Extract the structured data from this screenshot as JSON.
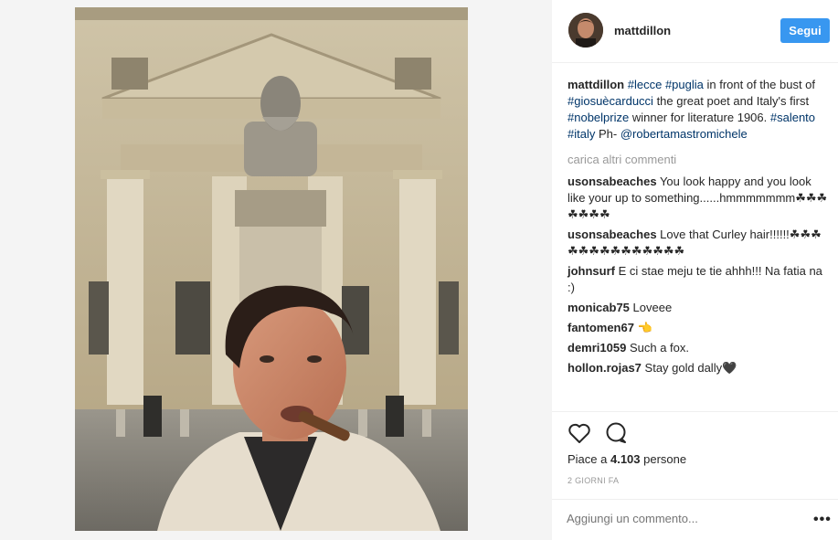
{
  "header": {
    "username": "mattdillon",
    "follow_label": "Segui"
  },
  "caption": {
    "username": "mattdillon",
    "segments": [
      {
        "t": "tag",
        "v": "#lecce"
      },
      {
        "t": "txt",
        "v": " "
      },
      {
        "t": "tag",
        "v": "#puglia"
      },
      {
        "t": "txt",
        "v": " in front of the bust of "
      },
      {
        "t": "tag",
        "v": "#giosuècarducci"
      },
      {
        "t": "txt",
        "v": " the great poet and Italy's first "
      },
      {
        "t": "tag",
        "v": "#nobelprize"
      },
      {
        "t": "txt",
        "v": " winner for literature 1906. "
      },
      {
        "t": "tag",
        "v": "#salento"
      },
      {
        "t": "txt",
        "v": " "
      },
      {
        "t": "tag",
        "v": "#italy"
      },
      {
        "t": "txt",
        "v": " Ph- "
      },
      {
        "t": "tag",
        "v": "@robertamastromichele"
      }
    ]
  },
  "load_more_label": "carica altri commenti",
  "comments": [
    {
      "user": "usonsabeaches",
      "text": "You look happy and you look like your up to something......hmmmmmmm☘☘☘☘☘☘☘"
    },
    {
      "user": "usonsabeaches",
      "text": "Love that Curley hair!!!!!!☘☘☘☘☘☘☘☘☘☘☘☘☘☘"
    },
    {
      "user": "johnsurf",
      "text": "E ci stae meju te tie ahhh!!! Na fatia na :)"
    },
    {
      "user": "monicab75",
      "text": "Loveee"
    },
    {
      "user": "fantomen67",
      "text": "👈"
    },
    {
      "user": "demri1059",
      "text": "Such a fox."
    },
    {
      "user": "hollon.rojas7",
      "text": "Stay gold dally🖤"
    }
  ],
  "actions": {
    "like_icon": "heart-outline-icon",
    "comment_icon": "speech-bubble-icon"
  },
  "likes": {
    "prefix": "Piace a ",
    "count": "4.103",
    "suffix": " persone"
  },
  "timestamp": "2 GIORNI FA",
  "add_comment_placeholder": "Aggiungi un commento...",
  "more_options_label": "•••",
  "colors": {
    "follow_button": "#3897f0",
    "hashtag": "#003569",
    "muted": "#999999"
  }
}
